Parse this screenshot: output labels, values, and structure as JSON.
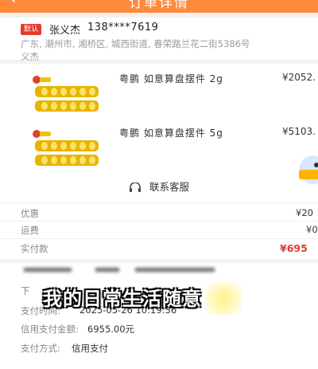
{
  "header": {
    "back_icon": "chevron-left-icon",
    "title": "订单详情"
  },
  "address": {
    "badge": "默认",
    "name": "张义杰",
    "phone": "138****7619",
    "line1": "广东, 潮州市, 湘桥区, 城西街道, 春荣路兰花二街5386号",
    "line2": "义杰"
  },
  "goods": [
    {
      "name": "粤鹏 如意算盘摆件 2g",
      "price": "¥2052."
    },
    {
      "name": "粤鹏 如意算盘摆件 5g",
      "price": "¥5103."
    }
  ],
  "service": {
    "icon": "headset-icon",
    "label": "联系客服"
  },
  "payment": {
    "discount_label": "优惠",
    "discount_value": "¥20",
    "shipping_label": "运费",
    "shipping_value": "¥0",
    "paid_label": "实付款",
    "paid_value": "¥695"
  },
  "order_info": {
    "row1_label": "下",
    "pay_time_label": "支付时间:",
    "pay_time_value": "2025-05-26 10:19:36",
    "credit_amount_label": "信用支付金额:",
    "credit_amount_value": "6955.00元",
    "pay_method_label": "支付方式:",
    "pay_method_value": "信用支付"
  },
  "overlay_text": "我的日常生活随意",
  "colors": {
    "header": "#ff8a3c",
    "badge": "#e23b2b",
    "paid": "#e23b2b"
  }
}
